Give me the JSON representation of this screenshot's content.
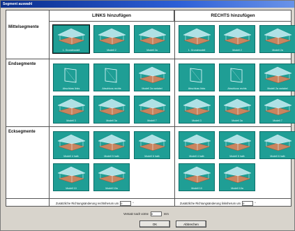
{
  "window": {
    "title": "Segment auswahl"
  },
  "headers": {
    "left": "LINKS hinzufügen",
    "right": "RECHTS hinzufügen"
  },
  "sections": {
    "mittel": "Mittelsegmente",
    "end": "Endsegmente",
    "eck": "Ecksegmente"
  },
  "left_tiles": {
    "mittel": [
      "1. Grundmodell",
      "Modell 2",
      "Modell 2a"
    ],
    "end_row1": [
      "Abschluss links",
      "Abschluss rechts",
      "Modell 2a variabel"
    ],
    "end_row2": [
      "Modell 3",
      "Modell 3a",
      "Modell 7"
    ],
    "eck_row1": [
      "Modell 4 halb",
      "Modell 5 halb",
      "Modell 6 halb"
    ],
    "eck_row2": [
      "Modell 10",
      "Modell 10a"
    ]
  },
  "right_tiles": {
    "mittel": [
      "1. Grundmodell",
      "Modell 2",
      "Modell 2a"
    ],
    "end_row1": [
      "Abschluss links",
      "Abschluss rechts",
      "Modell 2a variabel"
    ],
    "end_row2": [
      "Modell 3",
      "Modell 3a",
      "Modell 7"
    ],
    "eck_row1": [
      "Modell 4 halb",
      "Modell 5 halb",
      "Modell 6 halb"
    ],
    "eck_row2": [
      "Modell 10",
      "Modell 10a"
    ]
  },
  "angle": {
    "left_label": "Zusätzliche Richtungsänderung rechtsherum um",
    "left_value": "0",
    "right_label": "Zusätzliche Richtungsänderung linksherum um",
    "right_value": "0",
    "unit": "°"
  },
  "overlap": {
    "label": "Versatz nach vorne",
    "value": "0",
    "unit": "mm"
  },
  "buttons": {
    "ok": "OK",
    "cancel": "Abbrechen"
  },
  "colors": {
    "tile_bg": "#1f9e95",
    "floor": "#c9845f",
    "roof": "#bfe9ee"
  }
}
